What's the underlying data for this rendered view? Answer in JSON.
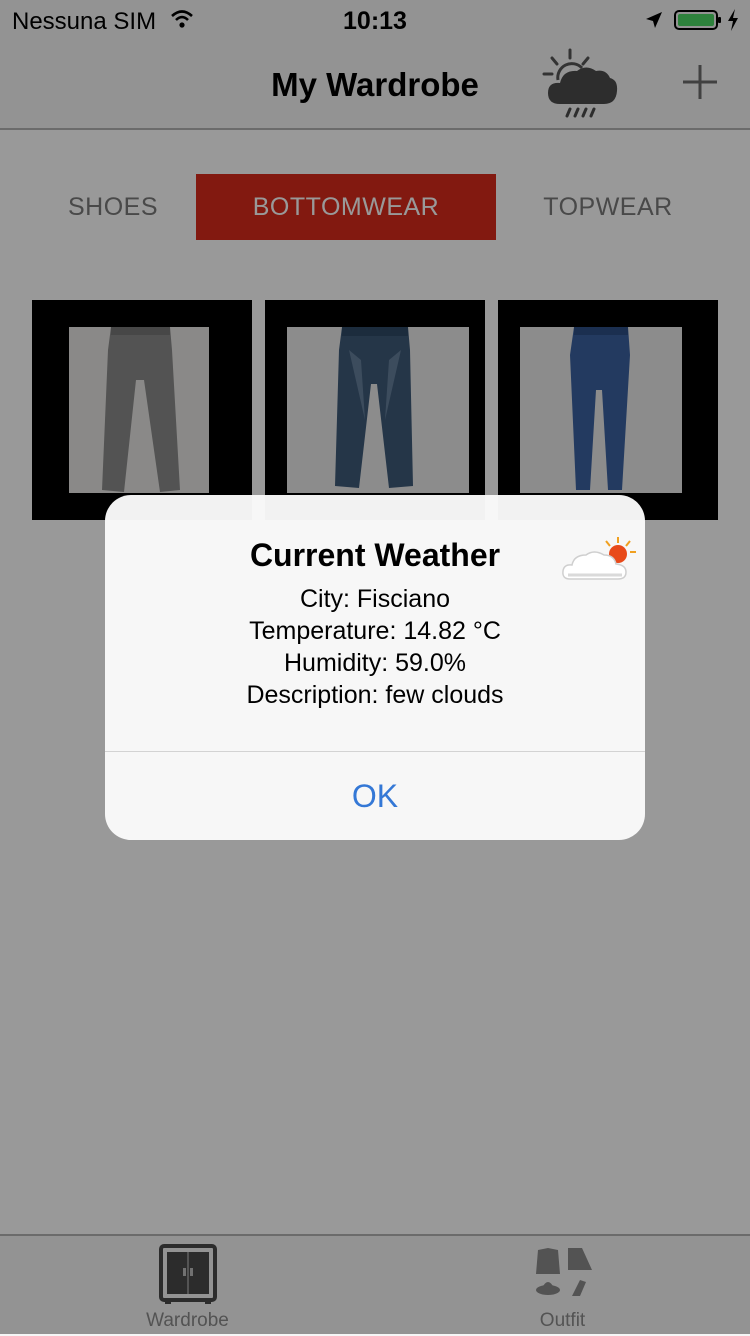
{
  "status_bar": {
    "carrier": "Nessuna SIM",
    "time": "10:13",
    "battery_color": "#4cd964"
  },
  "nav": {
    "title": "My Wardrobe",
    "weather_icon": "weather-rain-icon",
    "add_icon": "plus-icon"
  },
  "segments": [
    {
      "label": "SHOES",
      "selected": false
    },
    {
      "label": "BOTTOMWEAR",
      "selected": true
    },
    {
      "label": "TOPWEAR",
      "selected": false
    }
  ],
  "accent_color": "#d92a1c",
  "items": [
    {
      "name": "grey-trousers",
      "color": "#8b8b8b"
    },
    {
      "name": "faded-jeans",
      "color": "#3e5a78"
    },
    {
      "name": "blue-skinny-jeans",
      "color": "#3b62a0"
    }
  ],
  "alert": {
    "title": "Current Weather",
    "city": "City: Fisciano",
    "temperature": "Temperature: 14.82 °C",
    "humidity": "Humidity: 59.0%",
    "description": "Description: few clouds",
    "ok": "OK",
    "icon": "partly-cloudy-icon"
  },
  "tabs": [
    {
      "label": "Wardrobe",
      "icon": "wardrobe-icon"
    },
    {
      "label": "Outfit",
      "icon": "outfit-icon"
    }
  ]
}
